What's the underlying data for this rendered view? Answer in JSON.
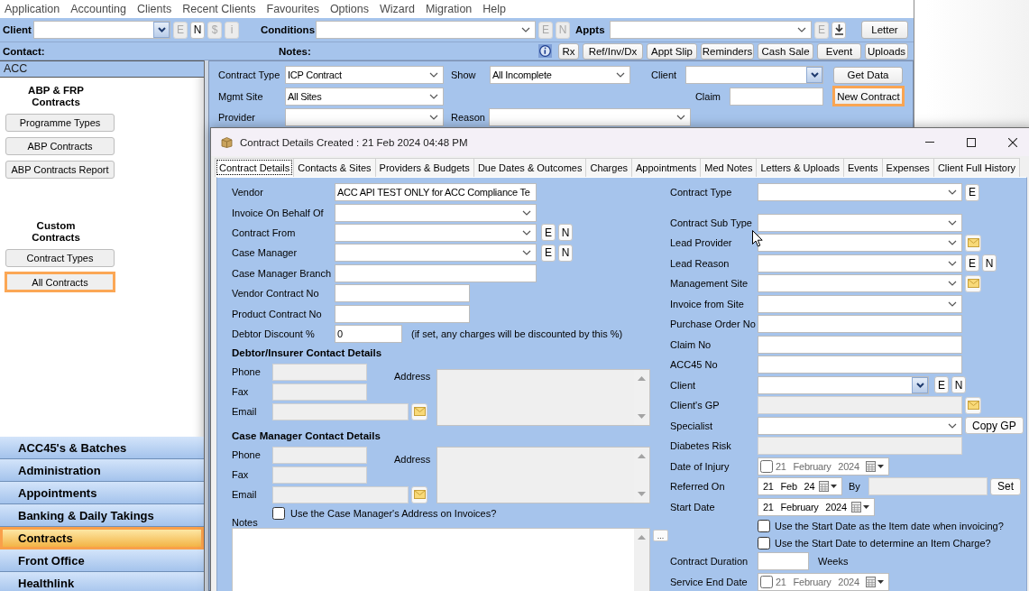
{
  "menu_bar": {
    "items": [
      "Application",
      "Accounting",
      "Clients",
      "Recent Clients",
      "Favourites",
      "Options",
      "Wizard",
      "Migration",
      "Help"
    ]
  },
  "toolbar": {
    "client": {
      "label": "Client",
      "buttons": [
        {
          "label": "E",
          "disabled": true
        },
        {
          "label": "N",
          "disabled": false
        },
        {
          "label": "$",
          "disabled": true
        },
        {
          "label": "i",
          "disabled": true
        }
      ]
    },
    "conditions": {
      "label": "Conditions",
      "buttons": [
        {
          "label": "E",
          "disabled": true
        },
        {
          "label": "N",
          "disabled": true
        }
      ]
    },
    "appts": {
      "label": "Appts",
      "buttons": [
        {
          "label": "E",
          "disabled": true
        }
      ]
    },
    "letter_button": "Letter",
    "contact_label": "Contact:",
    "notes_label": "Notes:",
    "buttons": [
      "Rx",
      "Ref/Inv/Dx",
      "Appt Slip",
      "Reminders",
      "Cash Sale",
      "Event",
      "Uploads"
    ]
  },
  "sidebar": {
    "header": "ACC",
    "groups": [
      {
        "title": "ABP & FRP Contracts",
        "buttons": [
          {
            "label": "Programme Types",
            "selected": false
          },
          {
            "label": "ABP Contracts",
            "selected": false
          },
          {
            "label": "ABP Contracts Report",
            "selected": false
          }
        ]
      },
      {
        "title": "Custom Contracts",
        "buttons": [
          {
            "label": "Contract Types",
            "selected": false
          },
          {
            "label": "All Contracts",
            "selected": true
          }
        ]
      }
    ],
    "nav": [
      {
        "label": "ACC45's & Batches",
        "selected": false
      },
      {
        "label": "Administration",
        "selected": false
      },
      {
        "label": "Appointments",
        "selected": false
      },
      {
        "label": "Banking & Daily Takings",
        "selected": false
      },
      {
        "label": "Contracts",
        "selected": true
      },
      {
        "label": "Front Office",
        "selected": false
      },
      {
        "label": "Healthlink",
        "selected": false
      }
    ]
  },
  "filters": {
    "contract_type": {
      "label": "Contract Type",
      "value": "ICP Contract"
    },
    "show": {
      "label": "Show",
      "value": "All Incomplete"
    },
    "client": {
      "label": "Client"
    },
    "mgmt_site": {
      "label": "Mgmt Site",
      "value": "All Sites"
    },
    "claim": {
      "label": "Claim"
    },
    "provider": {
      "label": "Provider"
    },
    "reason": {
      "label": "Reason"
    },
    "get_data_button": {
      "label": "Get Data",
      "highlighted": false
    },
    "new_contract_button": {
      "label": "New Contract",
      "highlighted": true
    }
  },
  "dialog": {
    "title": "Contract Details Created : 21 Feb 2024 04:48 PM",
    "tabs": [
      {
        "label": "Contract Details",
        "selected": true
      },
      {
        "label": "Contacts & Sites",
        "selected": false
      },
      {
        "label": "Providers & Budgets",
        "selected": false
      },
      {
        "label": "Due Dates & Outcomes",
        "selected": false
      },
      {
        "label": "Charges",
        "selected": false
      },
      {
        "label": "Appointments",
        "selected": false
      },
      {
        "label": "Med Notes",
        "selected": false
      },
      {
        "label": "Letters & Uploads",
        "selected": false
      },
      {
        "label": "Events",
        "selected": false
      },
      {
        "label": "Expenses",
        "selected": false
      },
      {
        "label": "Client Full History",
        "selected": false
      }
    ],
    "left_fields": [
      {
        "label": "Vendor",
        "kind": "text",
        "value": "ACC API TEST ONLY for ACC Compliance Te"
      },
      {
        "label": "Invoice On Behalf Of",
        "kind": "dropdown"
      },
      {
        "label": "Contract From",
        "kind": "dropdown",
        "buttons": [
          "E",
          "N"
        ]
      },
      {
        "label": "Case Manager",
        "kind": "dropdown",
        "buttons": [
          "E",
          "N"
        ]
      },
      {
        "label": "Case Manager Branch",
        "kind": "text"
      },
      {
        "label": "Vendor Contract No",
        "kind": "text"
      },
      {
        "label": "Product Contract No",
        "kind": "text"
      },
      {
        "label": "Debtor Discount %",
        "kind": "text",
        "value": "0",
        "note": "(if set, any charges will be discounted by this %)"
      }
    ],
    "contact_sections": [
      {
        "title": "Debtor/Insurer Contact Details",
        "fields": [
          {
            "label": "Phone"
          },
          {
            "label": "Fax"
          },
          {
            "label": "Email",
            "email_button": true
          }
        ],
        "address_label": "Address"
      },
      {
        "title": "Case Manager Contact Details",
        "fields": [
          {
            "label": "Phone"
          },
          {
            "label": "Fax"
          },
          {
            "label": "Email",
            "email_button": true
          }
        ],
        "address_label": "Address"
      }
    ],
    "use_cm_address": {
      "label": "Use the Case Manager's Address on Invoices?",
      "checked": false
    },
    "notes": {
      "label": "Notes",
      "button": "..."
    },
    "right_fields": [
      {
        "label": "Contract Type",
        "kind": "dropdown",
        "buttons": [
          "E"
        ]
      },
      {
        "label": "Contract Sub Type",
        "kind": "dropdown"
      },
      {
        "label": "Lead Provider",
        "kind": "dropdown",
        "email_button": true
      },
      {
        "label": "Lead Reason",
        "kind": "dropdown",
        "buttons": [
          "E",
          "N"
        ]
      },
      {
        "label": "Management Site",
        "kind": "dropdown",
        "email_button": true
      },
      {
        "label": "Invoice from Site",
        "kind": "dropdown"
      },
      {
        "label": "Purchase Order No",
        "kind": "text"
      },
      {
        "label": "Claim No",
        "kind": "text"
      },
      {
        "label": "ACC45 No",
        "kind": "text"
      },
      {
        "label": "Client",
        "kind": "combo",
        "buttons": [
          "E",
          "N"
        ]
      },
      {
        "label": "Client's GP",
        "kind": "readonly",
        "email_button": true
      },
      {
        "label": "Specialist",
        "kind": "dropdown",
        "buttons": [
          "Copy GP"
        ]
      },
      {
        "label": "Diabetes Risk",
        "kind": "readonly"
      },
      {
        "label": "Date of Injury",
        "kind": "date",
        "value": "21 February 2024",
        "checked": false
      },
      {
        "label": "Referred On",
        "kind": "date",
        "value": "21 Feb 24",
        "by_label": "By",
        "buttons": [
          "Set"
        ]
      },
      {
        "label": "Start Date",
        "kind": "date",
        "value": "21 February 2024"
      },
      {
        "label": "Use the Start Date as the Item date when invoicing?",
        "kind": "checkbox",
        "checked": false
      },
      {
        "label": "Use the Start Date to determine an Item Charge?",
        "kind": "checkbox",
        "checked": false
      },
      {
        "label": "Contract Duration",
        "kind": "text",
        "unit": "Weeks"
      },
      {
        "label": "Service End Date",
        "kind": "date",
        "value": "21 February 2024",
        "checked": false
      }
    ]
  }
}
